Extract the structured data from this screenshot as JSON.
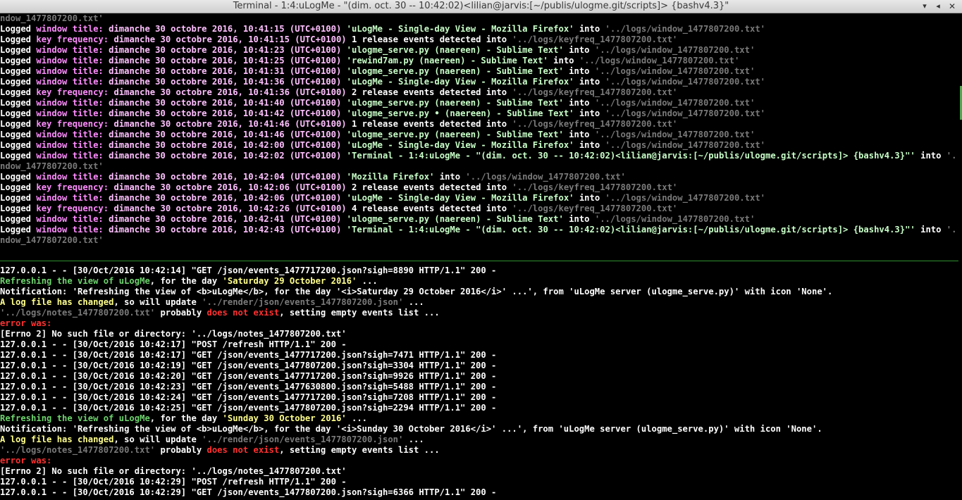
{
  "window": {
    "title": "Terminal - 1:4:uLogMe - \"(dim. oct. 30 -- 10:42:02)<lilian@jarvis:[~/publis/ulogme.git/scripts]> {bashv4.3}\"",
    "buttons": {
      "minimize": "▾",
      "maximize": "◂",
      "close": "✕"
    }
  },
  "colors": {
    "background": "#000000",
    "key": "#ff8cff",
    "date": "#ffc0ff",
    "string": "#c8ffc8",
    "path": "#7a7a7a",
    "green": "#6ed26e",
    "yellow": "#ffff8c",
    "red": "#ff3030",
    "divider": "#2f8f2f"
  },
  "top_pane": {
    "lines": [
      [
        {
          "c": "c-path",
          "t": "ndow_1477807200.txt'"
        }
      ],
      [
        {
          "c": "c-white",
          "t": "Logged "
        },
        {
          "c": "c-key",
          "t": "window title:"
        },
        {
          "c": "c-date",
          "t": " dimanche 30 octobre 2016, 10:41:15 (UTC+0100) "
        },
        {
          "c": "c-str",
          "t": "'uLogMe - Single-day View - Mozilla Firefox'"
        },
        {
          "c": "c-white",
          "t": " into "
        },
        {
          "c": "c-path",
          "t": "'../logs/window_1477807200.txt'"
        }
      ],
      [
        {
          "c": "c-white",
          "t": "Logged "
        },
        {
          "c": "c-key",
          "t": "key frequency:"
        },
        {
          "c": "c-date",
          "t": " dimanche 30 octobre 2016, 10:41:15 (UTC+0100) "
        },
        {
          "c": "c-white",
          "t": "1 release events detected into "
        },
        {
          "c": "c-path",
          "t": "'../logs/keyfreq_1477807200.txt'"
        }
      ],
      [
        {
          "c": "c-white",
          "t": "Logged "
        },
        {
          "c": "c-key",
          "t": "window title:"
        },
        {
          "c": "c-date",
          "t": " dimanche 30 octobre 2016, 10:41:23 (UTC+0100) "
        },
        {
          "c": "c-str",
          "t": "'ulogme_serve.py (naereen) - Sublime Text'"
        },
        {
          "c": "c-white",
          "t": " into "
        },
        {
          "c": "c-path",
          "t": "'../logs/window_1477807200.txt'"
        }
      ],
      [
        {
          "c": "c-white",
          "t": "Logged "
        },
        {
          "c": "c-key",
          "t": "window title:"
        },
        {
          "c": "c-date",
          "t": " dimanche 30 octobre 2016, 10:41:25 (UTC+0100) "
        },
        {
          "c": "c-str",
          "t": "'rewind7am.py (naereen) - Sublime Text'"
        },
        {
          "c": "c-white",
          "t": " into "
        },
        {
          "c": "c-path",
          "t": "'../logs/window_1477807200.txt'"
        }
      ],
      [
        {
          "c": "c-white",
          "t": "Logged "
        },
        {
          "c": "c-key",
          "t": "window title:"
        },
        {
          "c": "c-date",
          "t": " dimanche 30 octobre 2016, 10:41:31 (UTC+0100) "
        },
        {
          "c": "c-str",
          "t": "'ulogme_serve.py (naereen) - Sublime Text'"
        },
        {
          "c": "c-white",
          "t": " into "
        },
        {
          "c": "c-path",
          "t": "'../logs/window_1477807200.txt'"
        }
      ],
      [
        {
          "c": "c-white",
          "t": "Logged "
        },
        {
          "c": "c-key",
          "t": "window title:"
        },
        {
          "c": "c-date",
          "t": " dimanche 30 octobre 2016, 10:41:36 (UTC+0100) "
        },
        {
          "c": "c-str",
          "t": "'uLogMe - Single-day View - Mozilla Firefox'"
        },
        {
          "c": "c-white",
          "t": " into "
        },
        {
          "c": "c-path",
          "t": "'../logs/window_1477807200.txt'"
        }
      ],
      [
        {
          "c": "c-white",
          "t": "Logged "
        },
        {
          "c": "c-key",
          "t": "key frequency:"
        },
        {
          "c": "c-date",
          "t": " dimanche 30 octobre 2016, 10:41:36 (UTC+0100) "
        },
        {
          "c": "c-white",
          "t": "2 release events detected into "
        },
        {
          "c": "c-path",
          "t": "'../logs/keyfreq_1477807200.txt'"
        }
      ],
      [
        {
          "c": "c-white",
          "t": "Logged "
        },
        {
          "c": "c-key",
          "t": "window title:"
        },
        {
          "c": "c-date",
          "t": " dimanche 30 octobre 2016, 10:41:40 (UTC+0100) "
        },
        {
          "c": "c-str",
          "t": "'ulogme_serve.py (naereen) - Sublime Text'"
        },
        {
          "c": "c-white",
          "t": " into "
        },
        {
          "c": "c-path",
          "t": "'../logs/window_1477807200.txt'"
        }
      ],
      [
        {
          "c": "c-white",
          "t": "Logged "
        },
        {
          "c": "c-key",
          "t": "window title:"
        },
        {
          "c": "c-date",
          "t": " dimanche 30 octobre 2016, 10:41:42 (UTC+0100) "
        },
        {
          "c": "c-str",
          "t": "'ulogme_serve.py • (naereen) - Sublime Text'"
        },
        {
          "c": "c-white",
          "t": " into "
        },
        {
          "c": "c-path",
          "t": "'../logs/window_1477807200.txt'"
        }
      ],
      [
        {
          "c": "c-white",
          "t": "Logged "
        },
        {
          "c": "c-key",
          "t": "key frequency:"
        },
        {
          "c": "c-date",
          "t": " dimanche 30 octobre 2016, 10:41:46 (UTC+0100) "
        },
        {
          "c": "c-white",
          "t": "1 release events detected into "
        },
        {
          "c": "c-path",
          "t": "'../logs/keyfreq_1477807200.txt'"
        }
      ],
      [
        {
          "c": "c-white",
          "t": "Logged "
        },
        {
          "c": "c-key",
          "t": "window title:"
        },
        {
          "c": "c-date",
          "t": " dimanche 30 octobre 2016, 10:41:46 (UTC+0100) "
        },
        {
          "c": "c-str",
          "t": "'ulogme_serve.py (naereen) - Sublime Text'"
        },
        {
          "c": "c-white",
          "t": " into "
        },
        {
          "c": "c-path",
          "t": "'../logs/window_1477807200.txt'"
        }
      ],
      [
        {
          "c": "c-white",
          "t": "Logged "
        },
        {
          "c": "c-key",
          "t": "window title:"
        },
        {
          "c": "c-date",
          "t": " dimanche 30 octobre 2016, 10:42:00 (UTC+0100) "
        },
        {
          "c": "c-str",
          "t": "'uLogMe - Single-day View - Mozilla Firefox'"
        },
        {
          "c": "c-white",
          "t": " into "
        },
        {
          "c": "c-path",
          "t": "'../logs/window_1477807200.txt'"
        }
      ],
      [
        {
          "c": "c-white",
          "t": "Logged "
        },
        {
          "c": "c-key",
          "t": "window title:"
        },
        {
          "c": "c-date",
          "t": " dimanche 30 octobre 2016, 10:42:02 (UTC+0100) "
        },
        {
          "c": "c-str",
          "t": "'Terminal - 1:4:uLogMe - \"(dim. oct. 30 -- 10:42:02)<lilian@jarvis:[~/publis/ulogme.git/scripts]> {bashv4.3}\"'"
        },
        {
          "c": "c-white",
          "t": " into "
        },
        {
          "c": "c-path",
          "t": "'../logs/wi"
        }
      ],
      [
        {
          "c": "c-path",
          "t": "ndow_1477807200.txt'"
        }
      ],
      [
        {
          "c": "c-white",
          "t": "Logged "
        },
        {
          "c": "c-key",
          "t": "window title:"
        },
        {
          "c": "c-date",
          "t": " dimanche 30 octobre 2016, 10:42:04 (UTC+0100) "
        },
        {
          "c": "c-str",
          "t": "'Mozilla Firefox'"
        },
        {
          "c": "c-white",
          "t": " into "
        },
        {
          "c": "c-path",
          "t": "'../logs/window_1477807200.txt'"
        }
      ],
      [
        {
          "c": "c-white",
          "t": "Logged "
        },
        {
          "c": "c-key",
          "t": "key frequency:"
        },
        {
          "c": "c-date",
          "t": " dimanche 30 octobre 2016, 10:42:06 (UTC+0100) "
        },
        {
          "c": "c-white",
          "t": "2 release events detected into "
        },
        {
          "c": "c-path",
          "t": "'../logs/keyfreq_1477807200.txt'"
        }
      ],
      [
        {
          "c": "c-white",
          "t": "Logged "
        },
        {
          "c": "c-key",
          "t": "window title:"
        },
        {
          "c": "c-date",
          "t": " dimanche 30 octobre 2016, 10:42:06 (UTC+0100) "
        },
        {
          "c": "c-str",
          "t": "'uLogMe - Single-day View - Mozilla Firefox'"
        },
        {
          "c": "c-white",
          "t": " into "
        },
        {
          "c": "c-path",
          "t": "'../logs/window_1477807200.txt'"
        }
      ],
      [
        {
          "c": "c-white",
          "t": "Logged "
        },
        {
          "c": "c-key",
          "t": "key frequency:"
        },
        {
          "c": "c-date",
          "t": " dimanche 30 octobre 2016, 10:42:26 (UTC+0100) "
        },
        {
          "c": "c-white",
          "t": "4 release events detected into "
        },
        {
          "c": "c-path",
          "t": "'../logs/keyfreq_1477807200.txt'"
        }
      ],
      [
        {
          "c": "c-white",
          "t": "Logged "
        },
        {
          "c": "c-key",
          "t": "window title:"
        },
        {
          "c": "c-date",
          "t": " dimanche 30 octobre 2016, 10:42:41 (UTC+0100) "
        },
        {
          "c": "c-str",
          "t": "'ulogme_serve.py (naereen) - Sublime Text'"
        },
        {
          "c": "c-white",
          "t": " into "
        },
        {
          "c": "c-path",
          "t": "'../logs/window_1477807200.txt'"
        }
      ],
      [
        {
          "c": "c-white",
          "t": "Logged "
        },
        {
          "c": "c-key",
          "t": "window title:"
        },
        {
          "c": "c-date",
          "t": " dimanche 30 octobre 2016, 10:42:43 (UTC+0100) "
        },
        {
          "c": "c-str",
          "t": "'Terminal - 1:4:uLogMe - \"(dim. oct. 30 -- 10:42:02)<lilian@jarvis:[~/publis/ulogme.git/scripts]> {bashv4.3}\"'"
        },
        {
          "c": "c-white",
          "t": " into "
        },
        {
          "c": "c-path",
          "t": "'../logs/wi"
        }
      ],
      [
        {
          "c": "c-path",
          "t": "ndow_1477807200.txt'"
        }
      ]
    ]
  },
  "bottom_pane": {
    "lines": [
      [
        {
          "c": "c-white",
          "t": "127.0.0.1 - - [30/Oct/2016 10:42:14] \"GET /json/events_1477717200.json?sigh=8890 HTTP/1.1\" 200 -"
        }
      ],
      [
        {
          "c": "c-green",
          "t": "Refreshing the view of uLogMe"
        },
        {
          "c": "c-white",
          "t": ", for the day "
        },
        {
          "c": "c-yellow",
          "t": "'Saturday 29 October 2016'"
        },
        {
          "c": "c-white",
          "t": " ..."
        }
      ],
      [
        {
          "c": "c-white",
          "t": "Notification: 'Refreshing the view of <b>uLogMe</b>, for the day '<i>Saturday 29 October 2016</i>' ...', from 'uLogMe server (ulogme_serve.py)' with icon 'None'."
        }
      ],
      [
        {
          "c": "c-yellow",
          "t": "A log file has changed"
        },
        {
          "c": "c-white",
          "t": ", so will update "
        },
        {
          "c": "c-path",
          "t": "'../render/json/events_1477807200.json'"
        },
        {
          "c": "c-white",
          "t": " ..."
        }
      ],
      [
        {
          "c": "c-path",
          "t": "'../logs/notes_1477807200.txt'"
        },
        {
          "c": "c-white",
          "t": " probably "
        },
        {
          "c": "c-red",
          "t": "does not exist"
        },
        {
          "c": "c-white",
          "t": ", setting empty events list ..."
        }
      ],
      [
        {
          "c": "c-red",
          "t": "error was:"
        }
      ],
      [
        {
          "c": "c-white",
          "t": "[Errno 2] No such file or directory: '../logs/notes_1477807200.txt'"
        }
      ],
      [
        {
          "c": "c-white",
          "t": "127.0.0.1 - - [30/Oct/2016 10:42:17] \"POST /refresh HTTP/1.1\" 200 -"
        }
      ],
      [
        {
          "c": "c-white",
          "t": "127.0.0.1 - - [30/Oct/2016 10:42:17] \"GET /json/events_1477717200.json?sigh=7471 HTTP/1.1\" 200 -"
        }
      ],
      [
        {
          "c": "c-white",
          "t": "127.0.0.1 - - [30/Oct/2016 10:42:19] \"GET /json/events_1477807200.json?sigh=3304 HTTP/1.1\" 200 -"
        }
      ],
      [
        {
          "c": "c-white",
          "t": "127.0.0.1 - - [30/Oct/2016 10:42:20] \"GET /json/events_1477717200.json?sigh=9926 HTTP/1.1\" 200 -"
        }
      ],
      [
        {
          "c": "c-white",
          "t": "127.0.0.1 - - [30/Oct/2016 10:42:23] \"GET /json/events_1477630800.json?sigh=5488 HTTP/1.1\" 200 -"
        }
      ],
      [
        {
          "c": "c-white",
          "t": "127.0.0.1 - - [30/Oct/2016 10:42:24] \"GET /json/events_1477717200.json?sigh=7208 HTTP/1.1\" 200 -"
        }
      ],
      [
        {
          "c": "c-white",
          "t": "127.0.0.1 - - [30/Oct/2016 10:42:25] \"GET /json/events_1477807200.json?sigh=2294 HTTP/1.1\" 200 -"
        }
      ],
      [
        {
          "c": "c-green",
          "t": "Refreshing the view of uLogMe"
        },
        {
          "c": "c-white",
          "t": ", for the day "
        },
        {
          "c": "c-yellow",
          "t": "'Sunday 30 October 2016'"
        },
        {
          "c": "c-white",
          "t": " ..."
        }
      ],
      [
        {
          "c": "c-white",
          "t": "Notification: 'Refreshing the view of <b>uLogMe</b>, for the day '<i>Sunday 30 October 2016</i>' ...', from 'uLogMe server (ulogme_serve.py)' with icon 'None'."
        }
      ],
      [
        {
          "c": "c-yellow",
          "t": "A log file has changed"
        },
        {
          "c": "c-white",
          "t": ", so will update "
        },
        {
          "c": "c-path",
          "t": "'../render/json/events_1477807200.json'"
        },
        {
          "c": "c-white",
          "t": " ..."
        }
      ],
      [
        {
          "c": "c-path",
          "t": "'../logs/notes_1477807200.txt'"
        },
        {
          "c": "c-white",
          "t": " probably "
        },
        {
          "c": "c-red",
          "t": "does not exist"
        },
        {
          "c": "c-white",
          "t": ", setting empty events list ..."
        }
      ],
      [
        {
          "c": "c-red",
          "t": "error was:"
        }
      ],
      [
        {
          "c": "c-white",
          "t": "[Errno 2] No such file or directory: '../logs/notes_1477807200.txt'"
        }
      ],
      [
        {
          "c": "c-white",
          "t": "127.0.0.1 - - [30/Oct/2016 10:42:29] \"POST /refresh HTTP/1.1\" 200 -"
        }
      ],
      [
        {
          "c": "c-white",
          "t": "127.0.0.1 - - [30/Oct/2016 10:42:29] \"GET /json/events_1477807200.json?sigh=6366 HTTP/1.1\" 200 -"
        }
      ]
    ]
  }
}
